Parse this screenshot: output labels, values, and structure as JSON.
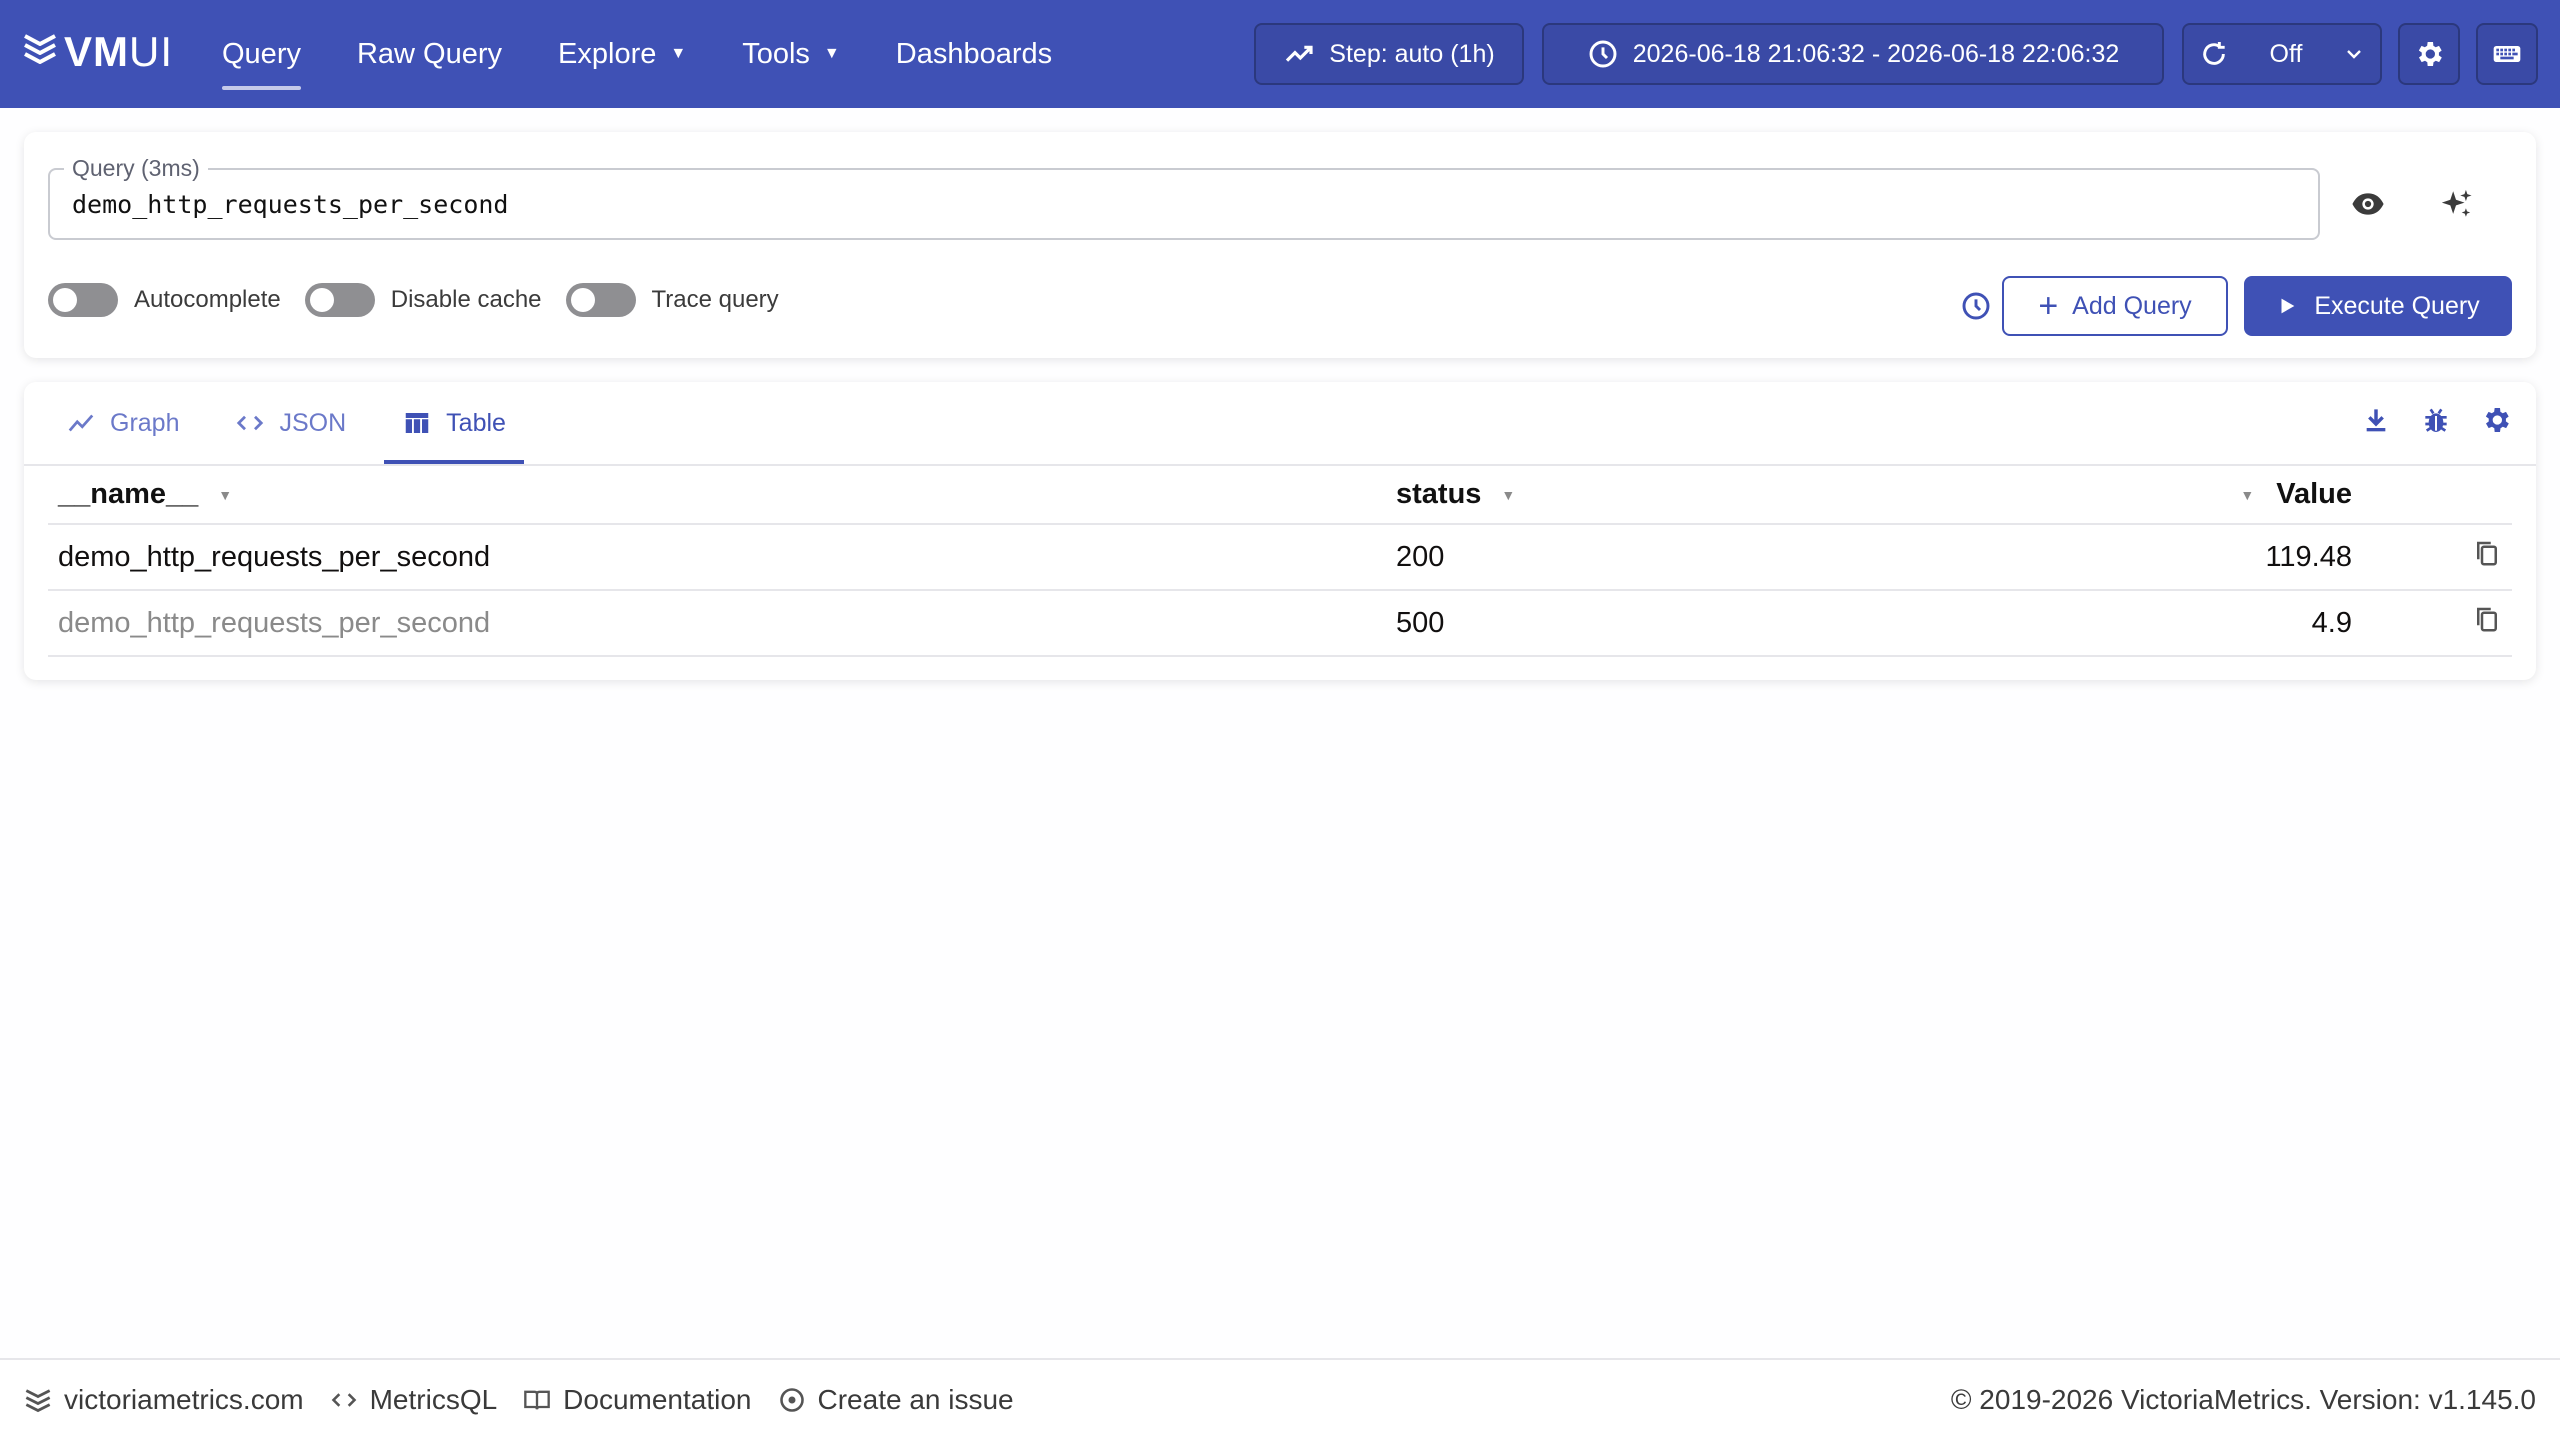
{
  "header": {
    "logo_main": "VM",
    "logo_sub": "UI",
    "nav": [
      {
        "label": "Query",
        "active": true
      },
      {
        "label": "Raw Query"
      },
      {
        "label": "Explore",
        "dropdown": true
      },
      {
        "label": "Tools",
        "dropdown": true
      },
      {
        "label": "Dashboards"
      }
    ],
    "step_label": "Step: auto (1h)",
    "time_range": "2026-06-18 21:06:32 - 2026-06-18 22:06:32",
    "refresh_value": "Off"
  },
  "query": {
    "label": "Query (3ms)",
    "value": "demo_http_requests_per_second",
    "toggles": [
      {
        "label": "Autocomplete",
        "on": false
      },
      {
        "label": "Disable cache",
        "on": false
      },
      {
        "label": "Trace query",
        "on": false
      }
    ],
    "add_label": "Add Query",
    "execute_label": "Execute Query"
  },
  "results": {
    "tabs": [
      {
        "label": "Graph",
        "icon": "chart-line-icon"
      },
      {
        "label": "JSON",
        "icon": "code-icon"
      },
      {
        "label": "Table",
        "icon": "table-icon",
        "active": true
      }
    ],
    "columns": [
      "__name__",
      "status",
      "Value"
    ],
    "rows": [
      {
        "name": "demo_http_requests_per_second",
        "status": "200",
        "value": "119.48"
      },
      {
        "name": "demo_http_requests_per_second",
        "status": "500",
        "value": "4.9"
      }
    ]
  },
  "footer": {
    "links": [
      {
        "label": "victoriametrics.com",
        "icon": "logo-icon"
      },
      {
        "label": "MetricsQL",
        "icon": "code-icon"
      },
      {
        "label": "Documentation",
        "icon": "book-icon"
      },
      {
        "label": "Create an issue",
        "icon": "issue-icon"
      }
    ],
    "copyright": "© 2019-2026 VictoriaMetrics. Version: v1.145.0"
  },
  "colors": {
    "primary": "#3f51b5",
    "background": "#fefeff"
  }
}
